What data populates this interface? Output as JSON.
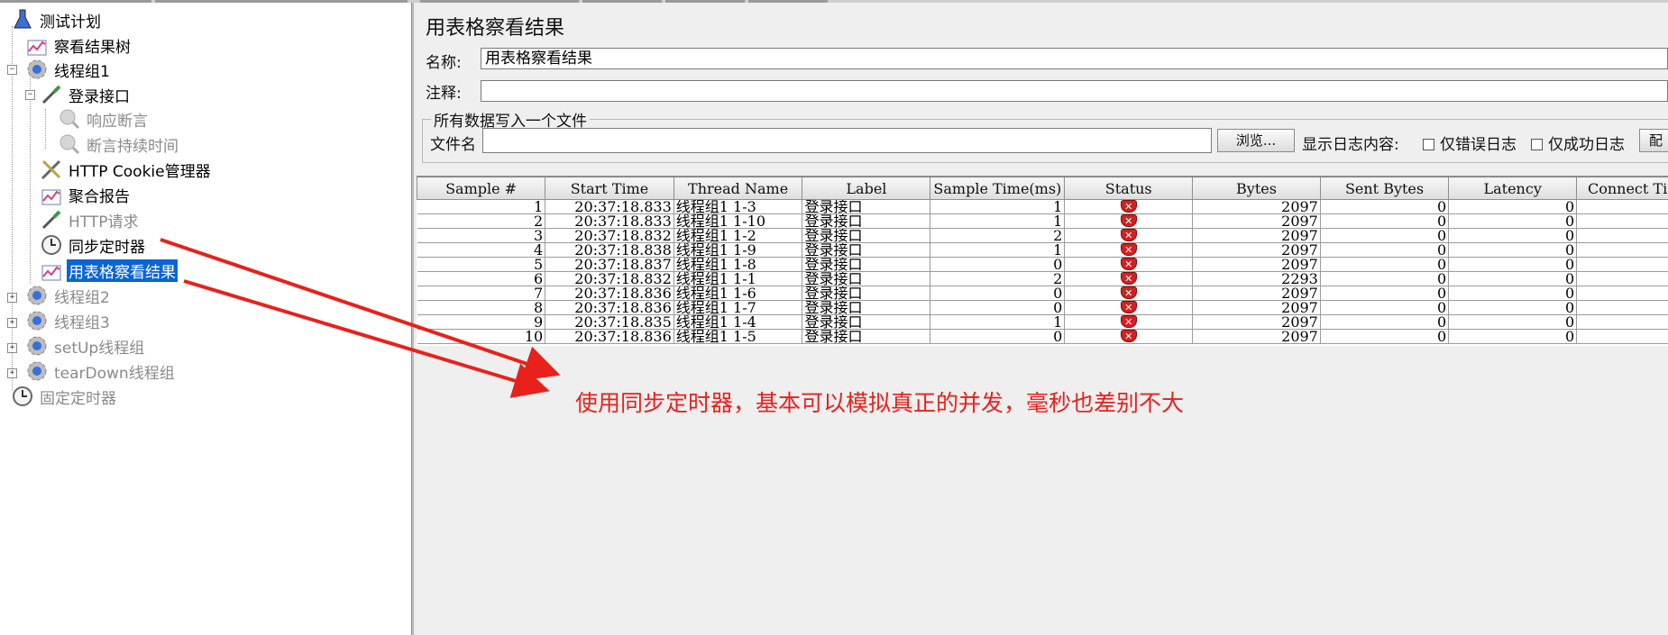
{
  "tree": {
    "items": [
      {
        "label": "测试计划",
        "icon": "test-plan-icon",
        "dim": false,
        "selected": false
      },
      {
        "label": "察看结果树",
        "icon": "listener-graph-icon",
        "dim": false,
        "selected": false
      },
      {
        "label": "线程组1",
        "icon": "thread-group-gear-icon",
        "dim": false,
        "selected": false
      },
      {
        "label": "登录接口",
        "icon": "sampler-pipette-icon",
        "dim": false,
        "selected": false
      },
      {
        "label": "响应断言",
        "icon": "assertion-magnifier-icon",
        "dim": true,
        "selected": false
      },
      {
        "label": "断言持续时间",
        "icon": "assertion-magnifier-icon",
        "dim": true,
        "selected": false
      },
      {
        "label": "HTTP Cookie管理器",
        "icon": "config-tools-icon",
        "dim": false,
        "selected": false
      },
      {
        "label": "聚合报告",
        "icon": "listener-graph-icon",
        "dim": false,
        "selected": false
      },
      {
        "label": "HTTP请求",
        "icon": "sampler-pipette-icon",
        "dim": true,
        "selected": false
      },
      {
        "label": "同步定时器",
        "icon": "timer-clock-icon",
        "dim": false,
        "selected": false
      },
      {
        "label": "用表格察看结果",
        "icon": "listener-graph-icon",
        "dim": false,
        "selected": true
      },
      {
        "label": "线程组2",
        "icon": "thread-group-gear-icon",
        "dim": true,
        "selected": false
      },
      {
        "label": "线程组3",
        "icon": "thread-group-gear-icon",
        "dim": true,
        "selected": false
      },
      {
        "label": "setUp线程组",
        "icon": "thread-group-gear-icon",
        "dim": true,
        "selected": false
      },
      {
        "label": "tearDown线程组",
        "icon": "thread-group-gear-icon",
        "dim": true,
        "selected": false
      },
      {
        "label": "固定定时器",
        "icon": "timer-clock-icon",
        "dim": true,
        "selected": false
      }
    ]
  },
  "panel": {
    "title": "用表格察看结果",
    "name_label": "名称:",
    "name_value": "用表格察看结果",
    "comment_label": "注释:",
    "comment_value": "",
    "group_title": "所有数据写入一个文件",
    "file_label": "文件名",
    "file_value": "",
    "browse_label": "浏览...",
    "log_label": "显示日志内容:",
    "errors_only_label": "仅错误日志",
    "success_only_label": "仅成功日志",
    "config_label": "配"
  },
  "table": {
    "columns": [
      "Sample #",
      "Start Time",
      "Thread Name",
      "Label",
      "Sample Time(ms)",
      "Status",
      "Bytes",
      "Sent Bytes",
      "Latency",
      "Connect Ti"
    ],
    "rows": [
      [
        "1",
        "20:37:18.833",
        "线程组1 1-3",
        "登录接口",
        "1",
        "error",
        "2097",
        "0",
        "0",
        ""
      ],
      [
        "2",
        "20:37:18.833",
        "线程组1 1-10",
        "登录接口",
        "1",
        "error",
        "2097",
        "0",
        "0",
        ""
      ],
      [
        "3",
        "20:37:18.832",
        "线程组1 1-2",
        "登录接口",
        "2",
        "error",
        "2097",
        "0",
        "0",
        ""
      ],
      [
        "4",
        "20:37:18.838",
        "线程组1 1-9",
        "登录接口",
        "1",
        "error",
        "2097",
        "0",
        "0",
        ""
      ],
      [
        "5",
        "20:37:18.837",
        "线程组1 1-8",
        "登录接口",
        "0",
        "error",
        "2097",
        "0",
        "0",
        ""
      ],
      [
        "6",
        "20:37:18.832",
        "线程组1 1-1",
        "登录接口",
        "2",
        "error",
        "2293",
        "0",
        "0",
        ""
      ],
      [
        "7",
        "20:37:18.836",
        "线程组1 1-6",
        "登录接口",
        "0",
        "error",
        "2097",
        "0",
        "0",
        ""
      ],
      [
        "8",
        "20:37:18.836",
        "线程组1 1-7",
        "登录接口",
        "0",
        "error",
        "2097",
        "0",
        "0",
        ""
      ],
      [
        "9",
        "20:37:18.835",
        "线程组1 1-4",
        "登录接口",
        "1",
        "error",
        "2097",
        "0",
        "0",
        ""
      ],
      [
        "10",
        "20:37:18.836",
        "线程组1 1-5",
        "登录接口",
        "0",
        "error",
        "2097",
        "0",
        "0",
        ""
      ]
    ]
  },
  "annotation": {
    "text": "使用同步定时器，基本可以模拟真正的并发，毫秒也差别不大",
    "color": "#e8211b"
  },
  "colors": {
    "selection": "#0a64d6",
    "status_error": "#d62020"
  }
}
